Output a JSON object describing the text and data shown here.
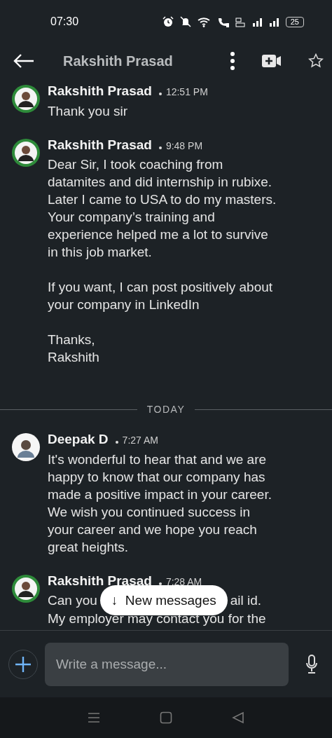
{
  "status_bar": {
    "time": "07:30",
    "battery": "25"
  },
  "header": {
    "title": "Rakshith Prasad"
  },
  "messages": [
    {
      "kind": "message",
      "avatar": {
        "kind": "ring"
      },
      "sender": "Rakshith Prasad",
      "time": "12:51 PM",
      "text": "Thank you sir"
    },
    {
      "kind": "message",
      "avatar": {
        "kind": "ring"
      },
      "sender": "Rakshith Prasad",
      "time": "9:48 PM",
      "text": "Dear Sir, I took coaching from\ndatamites and did internship in rubixe.\nLater I came to USA to do my masters.\nYour company’s training and\nexperience helped me a lot to survive\nin this job market.\n\nIf you want, I can post positively about\nyour company in LinkedIn\n\nThanks,\nRakshith"
    },
    {
      "kind": "divider",
      "label": "TODAY"
    },
    {
      "kind": "message",
      "avatar": {
        "kind": "plain"
      },
      "sender": "Deepak D",
      "time": "7:27 AM",
      "text": "It's wonderful to hear that and we  are\nhappy to know that our company has\nmade a positive impact in your career.\nWe wish you continued success in\nyour career and we hope you reach\ngreat heights."
    },
    {
      "kind": "covered",
      "avatar": {
        "kind": "ring"
      },
      "sender": "Rakshith Prasad",
      "time": "7:28 AM",
      "text_left": "Can you",
      "text_right": "ail id.",
      "text": "My employer may contact you for the"
    }
  ],
  "new_messages": {
    "label": "↓  New messages"
  },
  "composer": {
    "placeholder": "Write a message..."
  }
}
